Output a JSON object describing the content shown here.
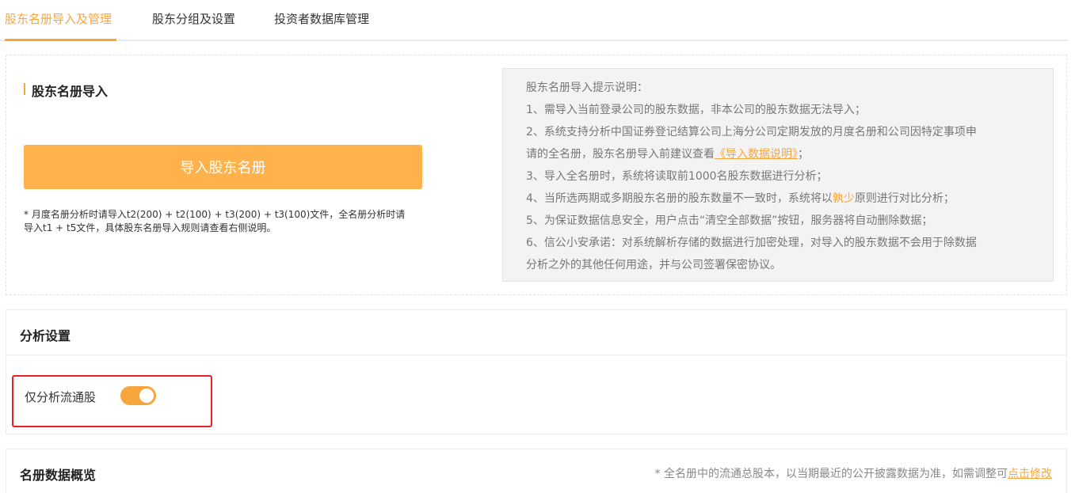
{
  "tabs": [
    {
      "label": "股东名册导入及管理",
      "active": true
    },
    {
      "label": "股东分组及设置",
      "active": false
    },
    {
      "label": "投资者数据库管理",
      "active": false
    }
  ],
  "upload": {
    "title": "股东名册导入",
    "button_label": "导入股东名册",
    "note_line1": "* 月度名册分析时请导入t2(200) + t2(100) + t3(200) + t3(100)文件，全名册分析时请",
    "note_line2": "导入t1 + t5文件，具体股东名册导入规则请查看右侧说明。"
  },
  "tips": {
    "heading": "股东名册导入提示说明：",
    "item1": "1、需导入当前登录公司的股东数据，非本公司的股东数据无法导入；",
    "item2a": "2、系统支持分析中国证券登记结算公司上海分公司定期发放的月度名册和公司因特定事项申",
    "item2b_prefix": "请的全名册，股东名册导入前建议查看",
    "item2b_link": "《导入数据说明》",
    "item2b_suffix": "；",
    "item3": "3、导入全名册时，系统将读取前1000名股东数据进行分析；",
    "item4_prefix": "4、当所选两期或多期股东名册的股东数量不一致时，系统将以",
    "item4_accent": "孰少",
    "item4_suffix": "原则进行对比分析；",
    "item5": "5、为保证数据信息安全，用户点击“清空全部数据”按钮，服务器将自动删除数据；",
    "item6a": "6、信公小安承诺：对系统解析存储的数据进行加密处理，对导入的股东数据不会用于除数据",
    "item6b": "分析之外的其他任何用途，并与公司签署保密协议。"
  },
  "analysis": {
    "title": "分析设置",
    "toggle_label": "仅分析流通股",
    "toggle_on": true
  },
  "overview": {
    "title": "名册数据概览",
    "note_prefix": "* 全名册中的流通总股本，以当期最近的公开披露数据为准，如需调整可",
    "note_link": "点击修改"
  },
  "colors": {
    "accent": "#f7a63e",
    "button": "#ffb14b",
    "highlight": "#e8222a"
  }
}
